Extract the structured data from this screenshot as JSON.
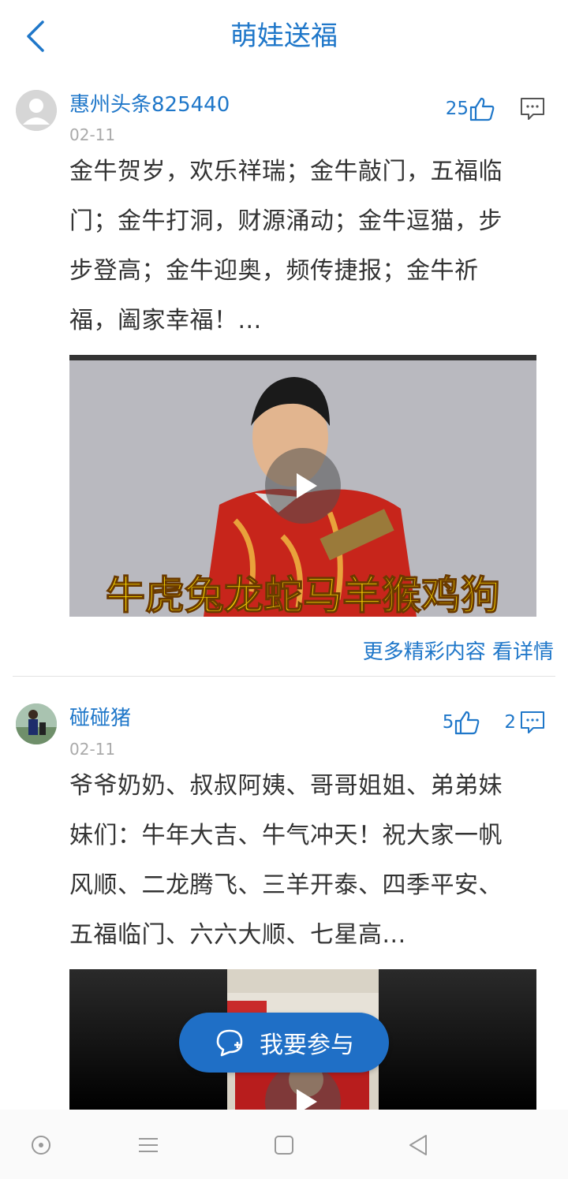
{
  "header": {
    "title": "萌娃送福",
    "back_icon": "chevron-left-icon"
  },
  "posts": [
    {
      "username": "惠州头条825440",
      "date": "02-11",
      "likes": "25",
      "comments": "",
      "content": "金牛贺岁，欢乐祥瑞；金牛敲门，五福临门；金牛打洞，财源涌动；金牛逗猫，步步登高；金牛迎奥，频传捷报；金牛祈福，阖家幸福！...",
      "video_caption": "牛虎兔龙蛇马羊猴鸡狗",
      "more_link": "更多精彩内容 看详情"
    },
    {
      "username": "碰碰猪",
      "date": "02-11",
      "likes": "5",
      "comments": "2",
      "content": "爷爷奶奶、叔叔阿姨、哥哥姐姐、弟弟妹妹们：牛年大吉、牛气冲天！祝大家一帆风顺、二龙腾飞、三羊开泰、四季平安、五福临门、六六大顺、七星高..."
    }
  ],
  "fab": {
    "label": "我要参与",
    "icon": "chat-plus-icon"
  },
  "navbar": {
    "icons": [
      "circle-dot-icon",
      "menu-icon",
      "square-icon",
      "triangle-back-icon"
    ]
  },
  "colors": {
    "accent": "#1f77c9",
    "fab": "#1f6fc6",
    "caption": "#f5d200"
  }
}
